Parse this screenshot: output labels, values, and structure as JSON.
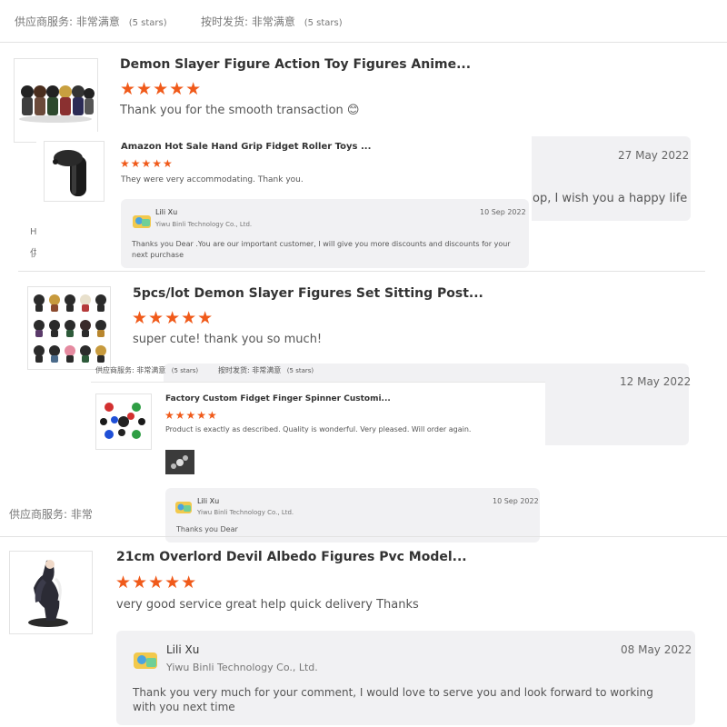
{
  "top_ratings": {
    "supplier_label": "供应商服务: 非常满意",
    "supplier_stars": "(5 stars)",
    "ontime_label": "按时发货: 非常满意",
    "ontime_stars": "(5 stars)"
  },
  "review1": {
    "title": "Demon Slayer Figure Action Toy Figures Anime...",
    "stars": "★★★★★",
    "rating": 5,
    "text": "Thank you for the smooth transaction 😊",
    "date": "27 May 2022",
    "reply_tail": "op, I wish you a happy life"
  },
  "review2": {
    "title": "Amazon Hot Sale Hand Grip Fidget Roller Toys ...",
    "stars": "★★★★★",
    "rating": 5,
    "text": "They were very accommodating. Thank you.",
    "reply": {
      "name": "Lili Xu",
      "company": "Yiwu Binli Technology Co., Ltd.",
      "date": "10 Sep 2022",
      "text": "Thanks you Dear .You are our important customer, I will give you more discounts and discounts for your next purchase"
    }
  },
  "partial_left": {
    "line1": "Ho",
    "line2": "供"
  },
  "review3": {
    "title": "5pcs/lot Demon Slayer Figures Set Sitting Post...",
    "stars": "★★★★★",
    "rating": 5,
    "text": "super cute! thank you so much!",
    "date": "12 May 2022"
  },
  "mid_ratings": {
    "supplier_label": "供应商服务: 非常满意",
    "supplier_stars": "(5 stars)",
    "ontime_label": "按时发货: 非常满意",
    "ontime_stars": "(5 stars)"
  },
  "review4": {
    "title": "Factory Custom Fidget Finger Spinner Customi...",
    "stars": "★★★★★",
    "rating": 5,
    "text": "Product is exactly as described.  Quality is wonderful.  Very pleased.  Will order again.",
    "reply": {
      "name": "Lili Xu",
      "company": "Yiwu Binli Technology Co., Ltd.",
      "date": "10 Sep 2022",
      "text": "Thanks you Dear"
    }
  },
  "partial_rating": {
    "label": "供应商服务: 非常"
  },
  "review5": {
    "title": "21cm Overlord Devil Albedo Figures Pvc Model...",
    "stars": "★★★★★",
    "rating": 5,
    "text": "very good service great help quick delivery Thanks",
    "reply": {
      "name": "Lili Xu",
      "company": "Yiwu Binli Technology Co., Ltd.",
      "date": "08 May 2022",
      "text": "Thank you very much for your comment, I would love to serve you and look forward to working with you next time"
    }
  }
}
